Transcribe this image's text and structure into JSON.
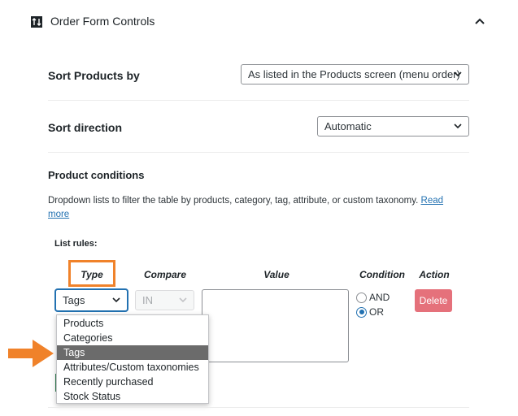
{
  "panel": {
    "title": "Order Form Controls",
    "icon": "sort-controls-icon",
    "collapse_icon": "chevron-up-icon"
  },
  "sort_products": {
    "label": "Sort Products by",
    "value": "As listed in the Products screen (menu order)"
  },
  "sort_direction": {
    "label": "Sort direction",
    "value": "Automatic"
  },
  "product_conditions": {
    "heading": "Product conditions",
    "description": "Dropdown lists to filter the table by products, category, tag, attribute, or custom taxonomy.",
    "read_more_line1": "Read",
    "read_more_line2": "more"
  },
  "rules": {
    "label": "List rules:",
    "columns": {
      "type": "Type",
      "compare": "Compare",
      "value": "Value",
      "condition": "Condition",
      "action": "Action"
    },
    "row": {
      "type_value": "Tags",
      "compare_value": "IN",
      "value_text": "",
      "condition_options": [
        {
          "label": "AND",
          "checked": false
        },
        {
          "label": "OR",
          "checked": true
        }
      ],
      "delete_label": "Delete"
    }
  },
  "type_dropdown": {
    "options": [
      "Products",
      "Categories",
      "Tags",
      "Attributes/Custom taxonomies",
      "Recently purchased",
      "Stock Status"
    ],
    "selected": "Tags"
  },
  "colors": {
    "highlight": "#f0822a",
    "link": "#2271b1",
    "delete_button": "#e5717b",
    "selected_option": "#6b6b6b"
  }
}
